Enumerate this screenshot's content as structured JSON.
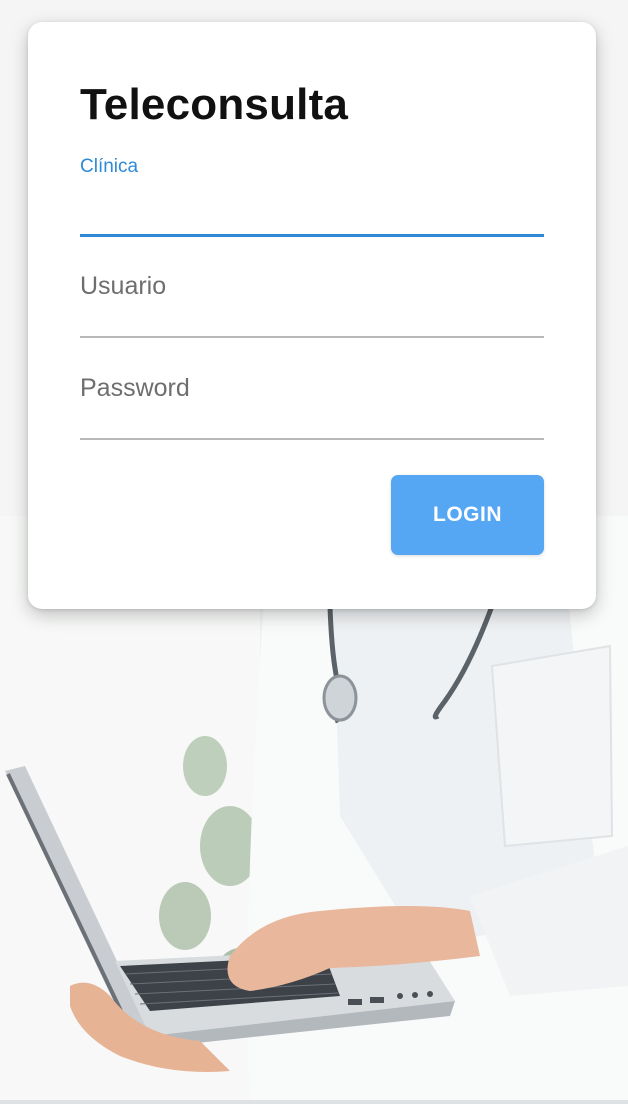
{
  "login": {
    "title": "Teleconsulta",
    "clinic_label": "Clínica",
    "clinic_value": "",
    "user_placeholder": "Usuario",
    "password_placeholder": "Password",
    "login_button": "LOGIN"
  },
  "background": {
    "image": "doctor-with-laptop-photo"
  },
  "colors": {
    "accent": "#2f8ad6",
    "button": "#55a7f3"
  }
}
